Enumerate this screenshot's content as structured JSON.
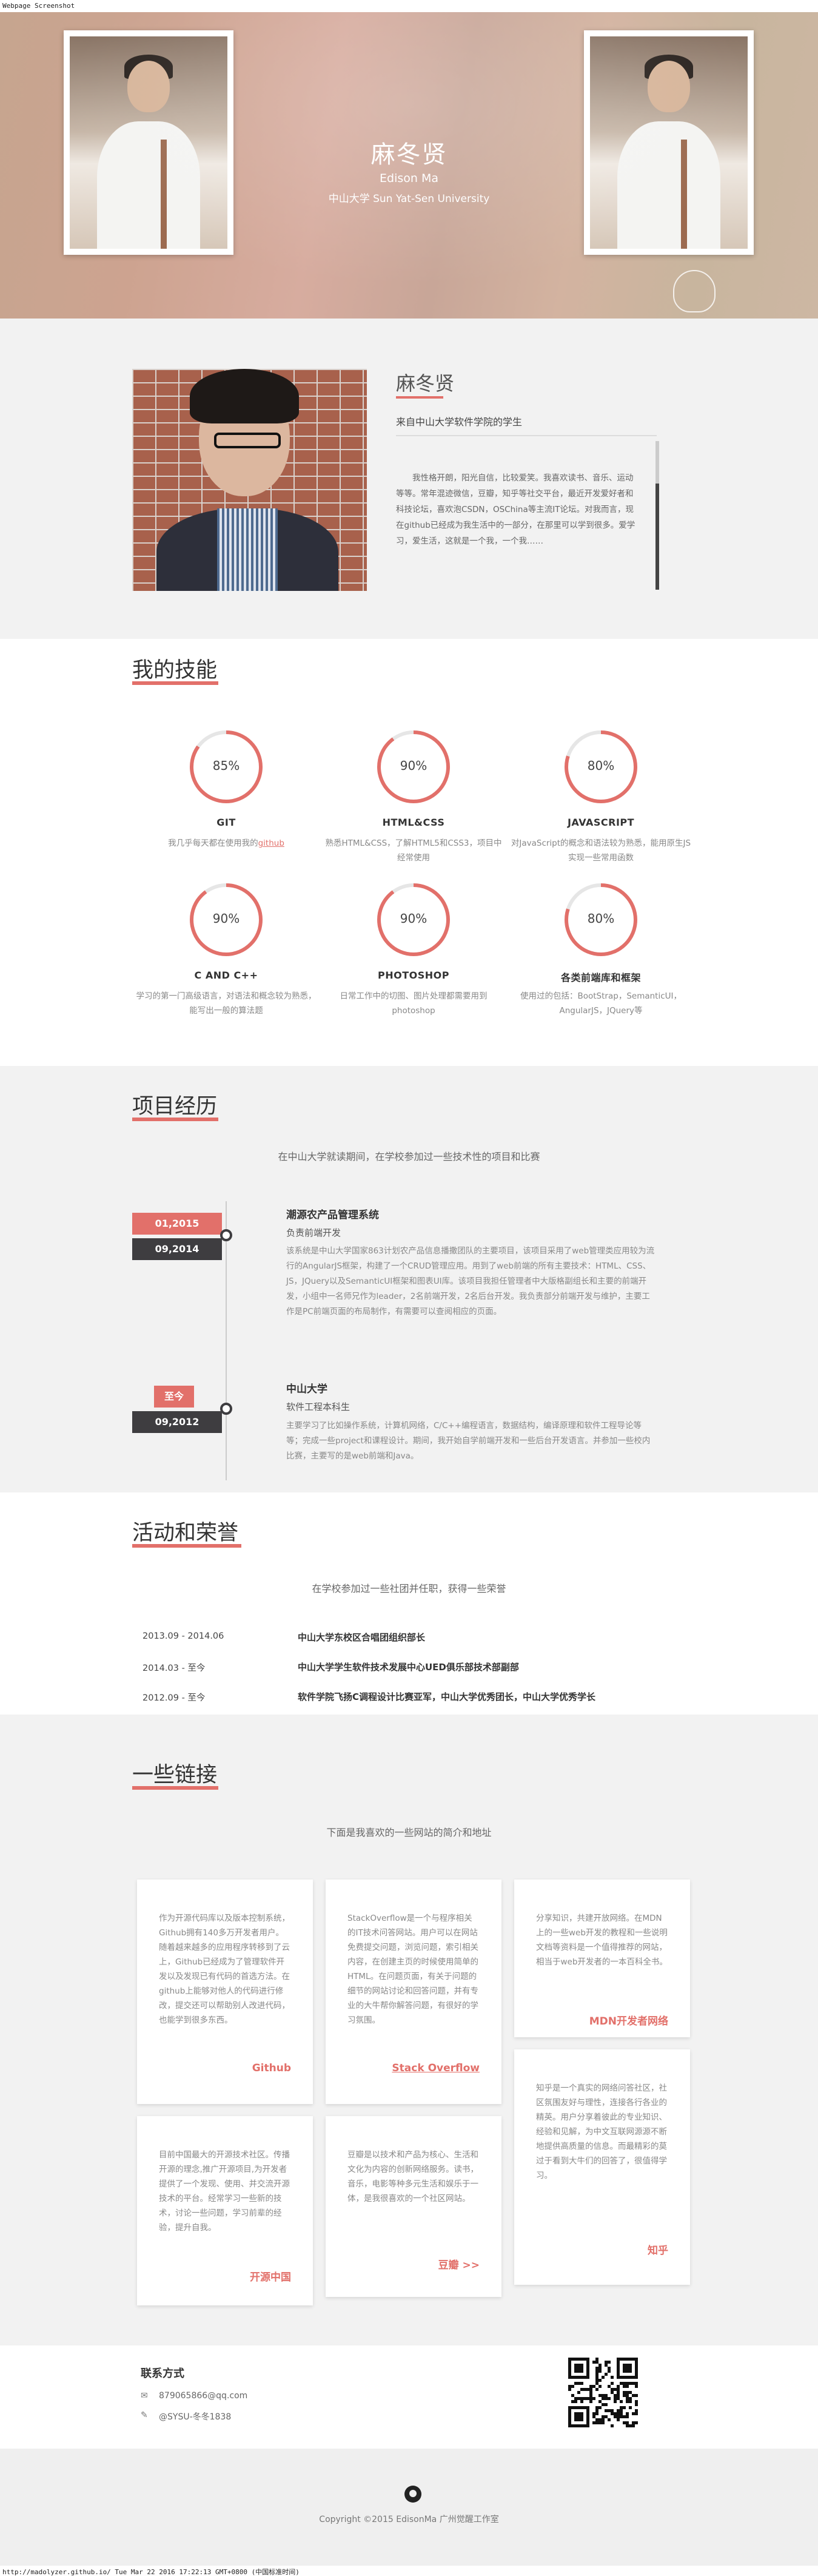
{
  "window": {
    "label": "Webpage Screenshot"
  },
  "hero": {
    "name": "麻冬贤",
    "english_name": "Edison Ma",
    "university": "中山大学 Sun Yat-Sen University"
  },
  "about": {
    "name": "麻冬贤",
    "from": "来自中山大学软件学院的学生",
    "description": "我性格开朗，阳光自信，比较爱笑。我喜欢读书、音乐、运动等等。常年混迹微信，豆瓣，知乎等社交平台，最近开发爱好者和科技论坛，喜欢泡CSDN，OSChina等主流IT论坛。对我而言，现在github已经成为我生活中的一部分，在那里可以学到很多。爱学习，爱生活，这就是一个我，一个我……"
  },
  "skills": {
    "title": "我的技能",
    "items": [
      {
        "percent_label": "85%",
        "percent": 85,
        "name": "GIT",
        "desc": "我几乎每天都在使用我的",
        "link": "github"
      },
      {
        "percent_label": "90%",
        "percent": 90,
        "name": "HTML&CSS",
        "desc": "熟悉HTML&CSS，了解HTML5和CSS3，项目中经常使用"
      },
      {
        "percent_label": "80%",
        "percent": 80,
        "name": "JAVASCRIPT",
        "desc": "对JavaScript的概念和语法较为熟悉，能用原生JS实现一些常用函数"
      },
      {
        "percent_label": "90%",
        "percent": 90,
        "name": "C AND C++",
        "desc": "学习的第一门高级语言，对语法和概念较为熟悉，能写出一般的算法题"
      },
      {
        "percent_label": "90%",
        "percent": 90,
        "name": "PHOTOSHOP",
        "desc": "日常工作中的切图、图片处理都需要用到photoshop"
      },
      {
        "percent_label": "80%",
        "percent": 80,
        "name": "各类前端库和框架",
        "desc": "使用过的包括：BootStrap，SemanticUI，AngularJS，JQuery等"
      }
    ]
  },
  "projects": {
    "title": "项目经历",
    "subtitle": "在中山大学就读期间，在学校参加过一些技术性的项目和比赛",
    "items": [
      {
        "date_start": "01,2015",
        "date_end": "09,2014",
        "title": "潮源农产品管理系统",
        "role": "负责前端开发",
        "desc": "该系统是中山大学国家863计划农产品信息播撒团队的主要项目，该项目采用了web管理类应用较为流行的AngularJS框架，构建了一个CRUD管理应用。用到了web前端的所有主要技术：HTML、CSS、JS，JQuery以及SemanticUI框架和图表UI库。该项目我担任管理者中大版格副组长和主要的前端开发，小组中一名师兄作为leader，2名前端开发，2名后台开发。我负责部分前端开发与维护，主要工作是PC前端页面的布局制作，有需要可以查阅相应的页面。"
      },
      {
        "date_start": "至今",
        "date_end": "09,2012",
        "title": "中山大学",
        "role": "软件工程本科生",
        "desc": "主要学习了比如操作系统，计算机网络，C/C++编程语言，数据结构，编译原理和软件工程导论等等；完成一些project和课程设计。期间，我开始自学前端开发和一些后台开发语言。并参加一些校内比赛，主要写的是web前端和Java。"
      }
    ]
  },
  "activities": {
    "title": "活动和荣誉",
    "subtitle": "在学校参加过一些社团并任职，获得一些荣誉",
    "items": [
      {
        "date": "2013.09 - 2014.06",
        "text": "中山大学东校区合唱团组织部长"
      },
      {
        "date": "2014.03 - 至今",
        "text": "中山大学学生软件技术发展中心UED俱乐部技术部副部"
      },
      {
        "date": "2012.09 - 至今",
        "text": "软件学院飞扬C调程设计比赛亚军，中山大学优秀团长，中山大学优秀学长"
      }
    ]
  },
  "links": {
    "title": "一些链接",
    "subtitle": "下面是我喜欢的一些网站的简介和地址",
    "items": [
      {
        "text": "作为开源代码库以及版本控制系统，Github拥有140多万开发者用户。随着越来越多的应用程序转移到了云上，Github已经成为了管理软件开发以及发现已有代码的首选方法。在github上能够对他人的代码进行修改，提交还可以帮助别人改进代码，也能学到很多东西。",
        "link": "Github"
      },
      {
        "text": "StackOverflow是一个与程序相关的IT技术问答网站。用户可以在网站免费提交问题，浏览问题，索引相关内容，在创建主页的时候使用简单的HTML。在问题页面，有关于问题的细节的网站讨论和回答问题，并有专业的大牛帮你解答问题，有很好的学习氛围。",
        "link": "Stack Overflow"
      },
      {
        "text": "分享知识，共建开放网络。在MDN上的一些web开发的教程和一些说明文档等资料是一个值得推荐的网站，相当于web开发者的一本百科全书。",
        "link": "MDN开发者网络"
      },
      {
        "text": "目前中国最大的开源技术社区。传播开源的理念,推广开源项目,为开发者提供了一个发现、使用、并交流开源技术的平台。经常学习一些新的技术，讨论一些问题，学习前辈的经验，提升自我。",
        "link": "开源中国"
      },
      {
        "text": "豆瓣是以技术和产品为核心、生活和文化为内容的创新网络服务。读书，音乐，电影等种多元生活和娱乐于一体，是我很喜欢的一个社区网站。",
        "link": "豆瓣 >>"
      },
      {
        "text": "知乎是一个真实的网络问答社区，社区氛围友好与理性，连接各行各业的精英。用户分享着彼此的专业知识、经验和见解，为中文互联网源源不断地提供高质量的信息。而最精彩的莫过于看到大牛们的回答了，很值得学习。",
        "link": "知乎"
      }
    ]
  },
  "contact": {
    "title": "联系方式",
    "email": "879065866@qq.com",
    "weibo": "@SYSU-冬冬1838"
  },
  "footer": {
    "copyright": "Copyright ©2015 EdisonMa 广州觉醒工作室"
  },
  "status": {
    "text": "http://madolyzer.github.io/ Tue Mar 22 2016 17:22:13 GMT+0800 (中国标准时间)"
  },
  "colors": {
    "accent": "#e2706a",
    "dark": "#3e3d40"
  }
}
